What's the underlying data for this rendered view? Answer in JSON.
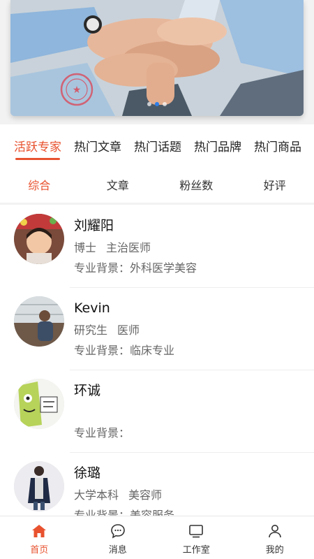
{
  "banner": {
    "slides": 3,
    "active_slide": 2,
    "colors": {
      "accent": "#e8522f",
      "dot_active": "#2f7ee8"
    }
  },
  "category_tabs": [
    {
      "label": "活跃专家",
      "active": true
    },
    {
      "label": "热门文章",
      "active": false
    },
    {
      "label": "热门话题",
      "active": false
    },
    {
      "label": "热门品牌",
      "active": false
    },
    {
      "label": "热门商品",
      "active": false
    }
  ],
  "sort_tabs": [
    {
      "label": "综合",
      "active": true
    },
    {
      "label": "文章",
      "active": false
    },
    {
      "label": "粉丝数",
      "active": false
    },
    {
      "label": "好评",
      "active": false
    }
  ],
  "experts": [
    {
      "name": "刘耀阳",
      "degree": "博士",
      "title": "主治医师",
      "background_label": "专业背景：",
      "background": "外科医学美容",
      "avatar_icon": "child-photo"
    },
    {
      "name": "Kevin",
      "degree": "研究生",
      "title": "医师",
      "background_label": "专业背景：",
      "background": "临床专业",
      "avatar_icon": "man-window-photo"
    },
    {
      "name": "环诚",
      "degree": "",
      "title": "",
      "background_label": "专业背景：",
      "background": "",
      "avatar_icon": "cartoon-sticker"
    },
    {
      "name": "徐璐",
      "degree": "大学本科",
      "title": "美容师",
      "background_label": "专业背景：",
      "background": "美容服务",
      "avatar_icon": "woman-coat-photo"
    }
  ],
  "bottom_nav": [
    {
      "label": "首页",
      "icon": "home-icon",
      "active": true
    },
    {
      "label": "消息",
      "icon": "message-icon",
      "active": false
    },
    {
      "label": "工作室",
      "icon": "monitor-icon",
      "active": false
    },
    {
      "label": "我的",
      "icon": "user-icon",
      "active": false
    }
  ]
}
